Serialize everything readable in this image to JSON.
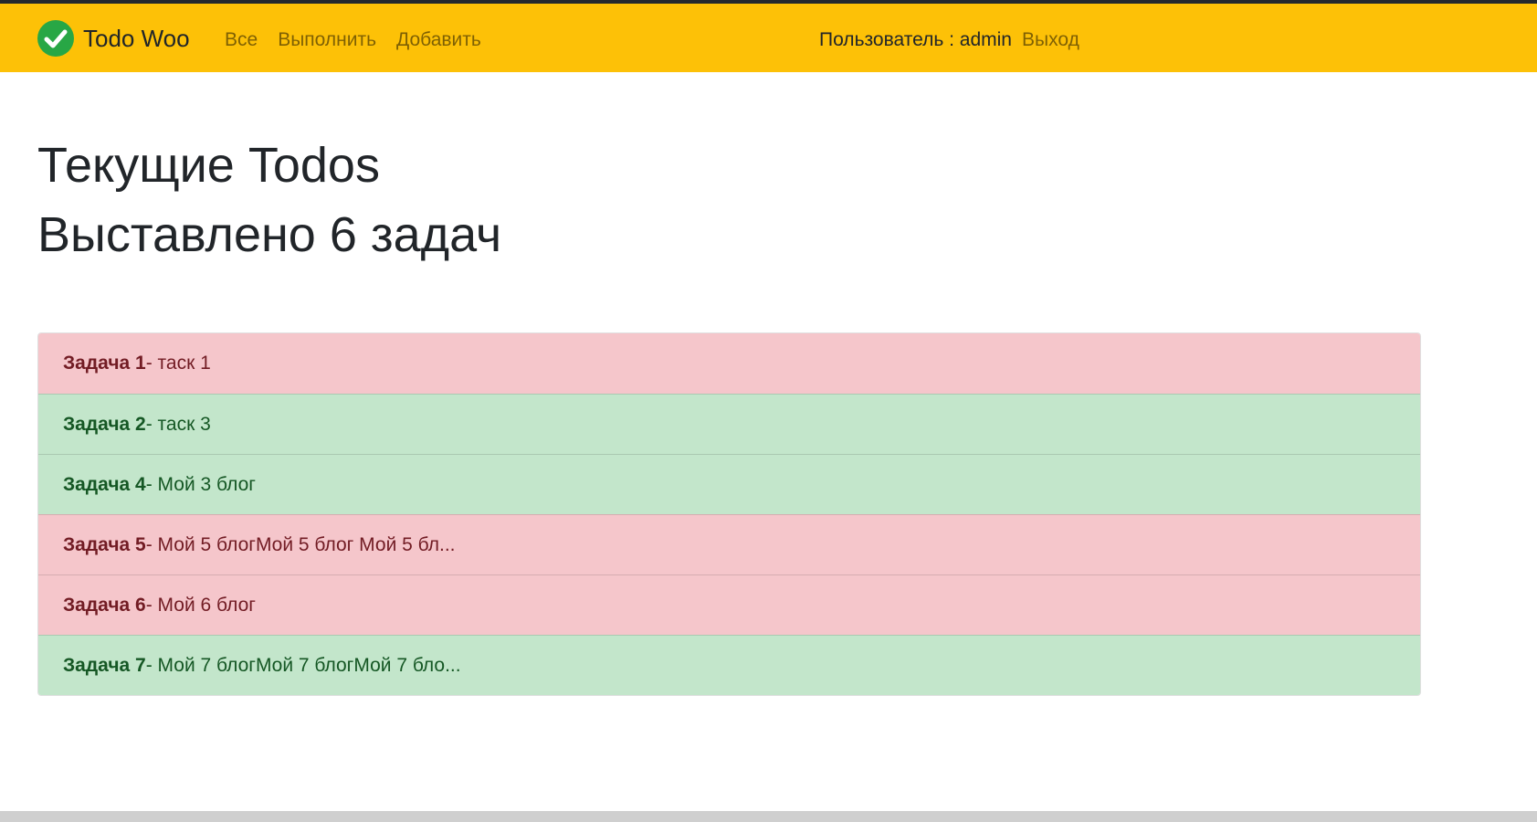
{
  "colors": {
    "navbar_bg": "#fdc107",
    "brand_icon": "#28a745",
    "pending_bg": "#f5c6cb",
    "pending_text": "#721c24",
    "done_bg": "#c3e6cb",
    "done_text": "#155724"
  },
  "navbar": {
    "brand_icon": "check-circle-icon",
    "brand": "Todo Woo",
    "links": [
      "Все",
      "Выполнить",
      "Добавить"
    ],
    "user_label": "Пользователь : admin",
    "logout": "Выход"
  },
  "page": {
    "title": "Текущие Todos",
    "subtitle": "Выставлено 6 задач"
  },
  "tasks": [
    {
      "label": "Задача 1",
      "text": " - таск 1",
      "status": "pending"
    },
    {
      "label": "Задача 2",
      "text": " - таск 3",
      "status": "done"
    },
    {
      "label": "Задача 4",
      "text": " - Мой 3 блог",
      "status": "done"
    },
    {
      "label": "Задача 5",
      "text": " - Мой 5 блогМой 5 блог Мой 5 бл...",
      "status": "pending"
    },
    {
      "label": "Задача 6",
      "text": " - Мой 6 блог",
      "status": "pending"
    },
    {
      "label": "Задача 7",
      "text": " - Мой 7 блогМой 7 блогМой 7 бло...",
      "status": "done"
    }
  ]
}
